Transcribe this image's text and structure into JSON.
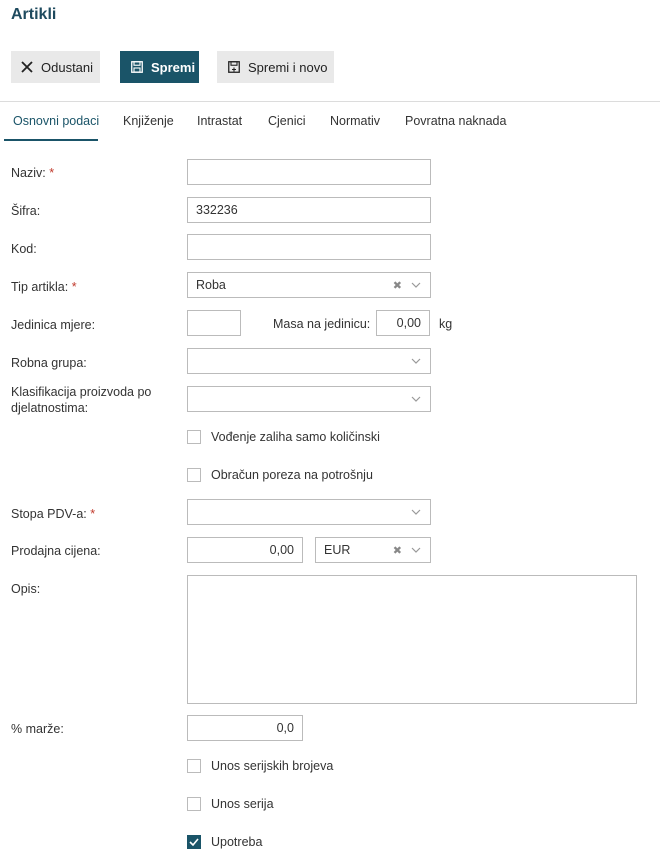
{
  "header": {
    "title": "Artikli"
  },
  "toolbar": {
    "cancel_label": "Odustani",
    "save_label": "Spremi",
    "save_new_label": "Spremi i novo"
  },
  "tabs": [
    {
      "label": "Osnovni podaci",
      "active": true
    },
    {
      "label": "Knjiženje"
    },
    {
      "label": "Intrastat"
    },
    {
      "label": "Cjenici"
    },
    {
      "label": "Normativ"
    },
    {
      "label": "Povratna naknada"
    }
  ],
  "form": {
    "naziv": {
      "label": "Naziv:",
      "required": "*",
      "value": ""
    },
    "sifra": {
      "label": "Šifra:",
      "value": "332236"
    },
    "kod": {
      "label": "Kod:",
      "value": ""
    },
    "tip_artikla": {
      "label": "Tip artikla:",
      "required": "*",
      "value": "Roba"
    },
    "jedinica_mjere": {
      "label": "Jedinica mjere:",
      "value": ""
    },
    "masa": {
      "label": "Masa na jedinicu:",
      "value": "0,00",
      "unit": "kg"
    },
    "robna_grupa": {
      "label": "Robna grupa:",
      "value": ""
    },
    "klasifikacija": {
      "label_line1": "Klasifikacija proizvoda po",
      "label_line2": "djelatnostima:",
      "value": ""
    },
    "vodjenje_zaliha": {
      "label": "Vođenje zaliha samo količinski",
      "checked": false
    },
    "obracun_poreza": {
      "label": "Obračun poreza na potrošnju",
      "checked": false
    },
    "stopa_pdv": {
      "label": "Stopa PDV-a:",
      "required": "*",
      "value": ""
    },
    "prodajna_cijena": {
      "label": "Prodajna cijena:",
      "value": "0,00",
      "currency": "EUR"
    },
    "opis": {
      "label": "Opis:",
      "value": ""
    },
    "marza": {
      "label": "% marže:",
      "value": "0,0"
    },
    "unos_serijskih": {
      "label": "Unos serijskih brojeva",
      "checked": false
    },
    "unos_serija": {
      "label": "Unos serija",
      "checked": false
    },
    "upotreba": {
      "label": "Upotreba",
      "checked": true
    }
  },
  "colors": {
    "primary": "#1a5468",
    "title": "#1e4a5e",
    "required": "#c0392b"
  },
  "icons": {
    "cancel": "close-icon",
    "save": "floppy-disk-icon",
    "save_new": "floppy-disk-plus-icon",
    "dropdown": "chevron-down-icon",
    "clear": "clear-x-icon",
    "checked": "checkmark-icon"
  }
}
